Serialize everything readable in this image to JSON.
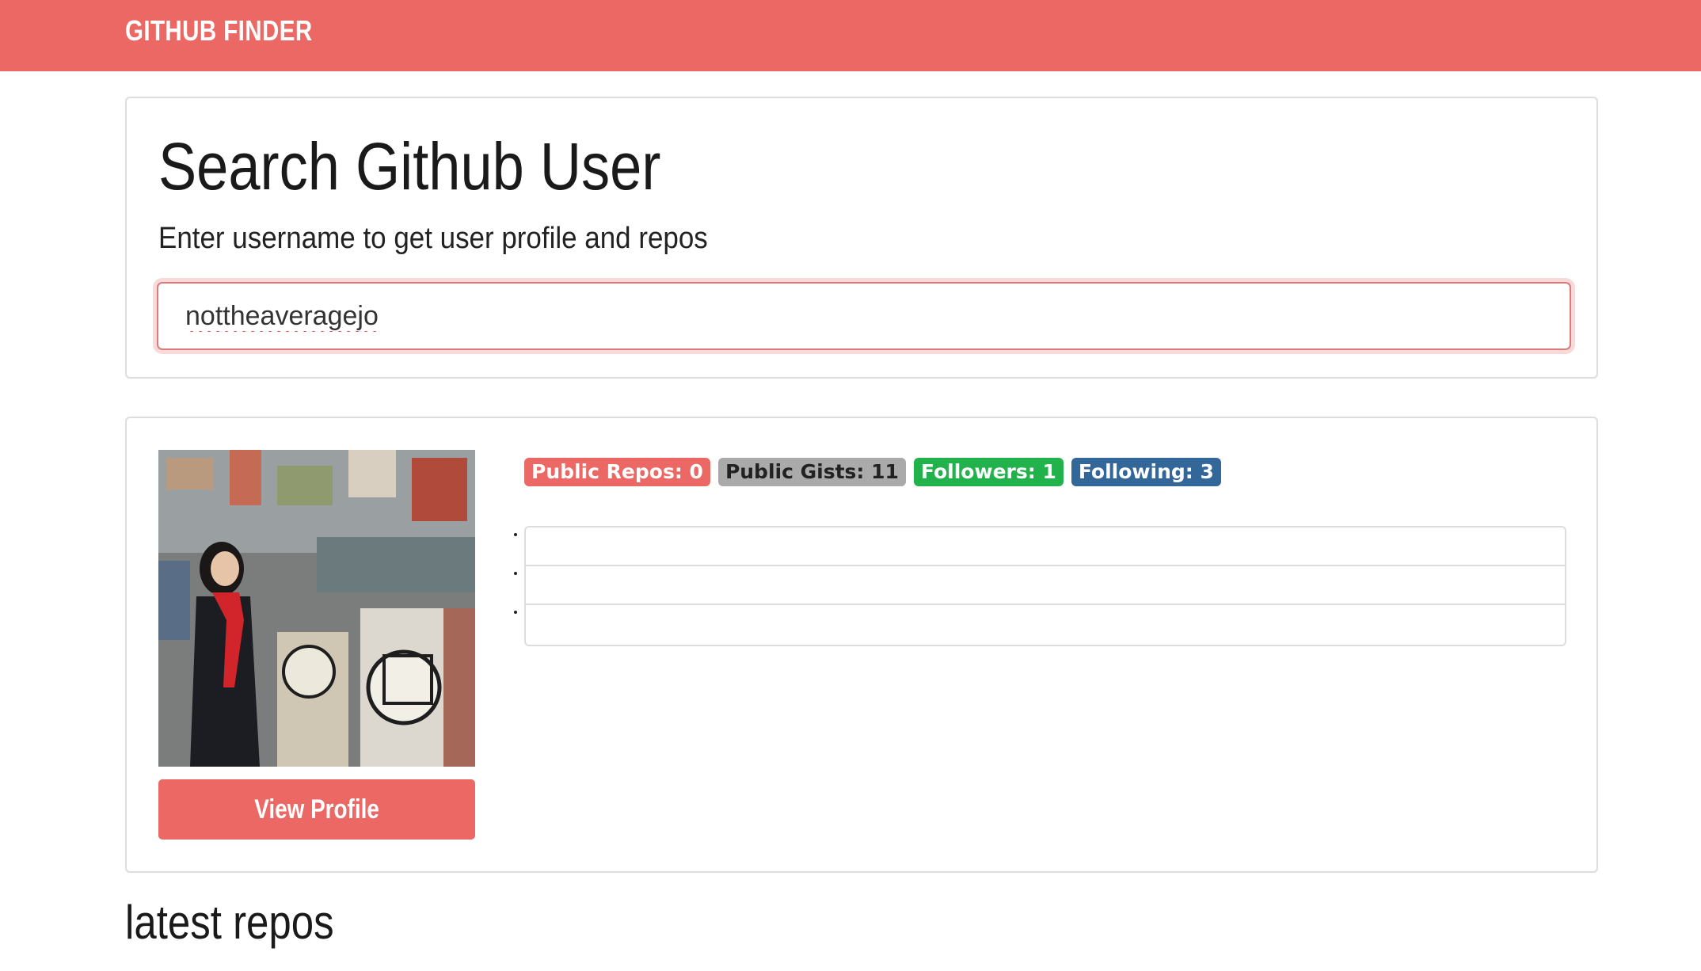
{
  "navbar": {
    "brand": "GITHUB FINDER"
  },
  "search": {
    "title": "Search Github User",
    "subtitle": "Enter username to get user profile and repos",
    "input_value": "nottheaveragejo"
  },
  "profile": {
    "view_profile_label": "View Profile",
    "badges": {
      "public_repos": "Public Repos: 0",
      "public_gists": "Public Gists: 11",
      "followers": "Followers: 1",
      "following": "Following: 3"
    }
  },
  "repos": {
    "heading": "latest repos"
  },
  "colors": {
    "brand": "#eb6864",
    "badge_gists": "#aaaaaa",
    "badge_followers": "#22b24c",
    "badge_following": "#336699"
  }
}
